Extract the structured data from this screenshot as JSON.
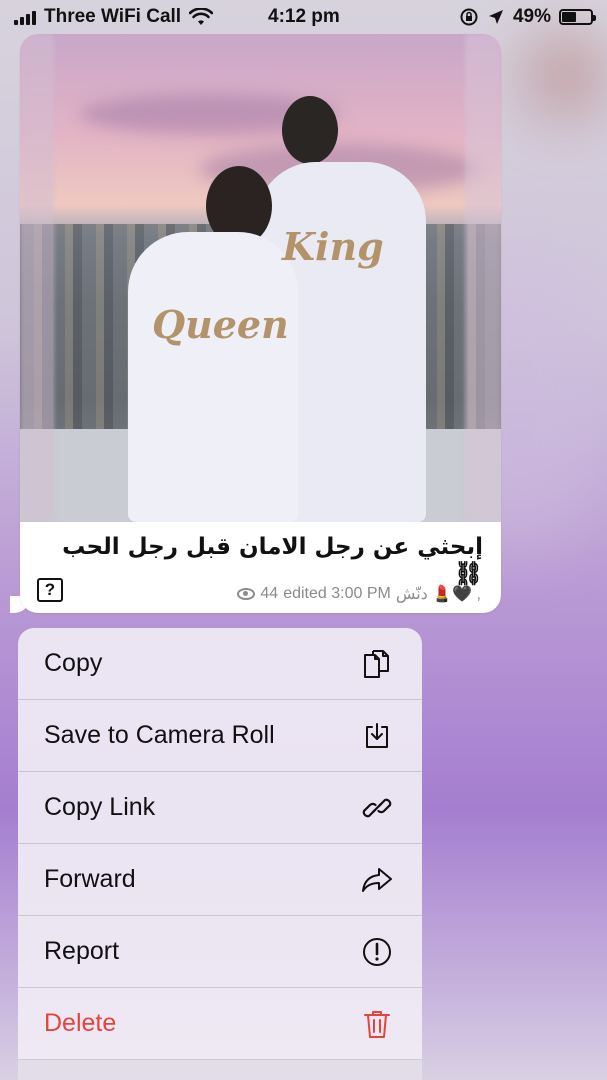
{
  "status_bar": {
    "carrier": "Three WiFi Call",
    "time": "4:12 pm",
    "battery": "49%",
    "battery_level": 0.49
  },
  "message": {
    "photo": {
      "robe_left_text": "Queen",
      "robe_right_text": "King"
    },
    "caption": "إبحثي عن رجل الامان قبل رجل الحب⛓",
    "caption_emoji": "?",
    "meta": {
      "views": "44",
      "info": "edited 3:00 PM",
      "signature": "دنّش 💄🖤 ,"
    }
  },
  "context_menu": {
    "items": [
      {
        "label": "Copy",
        "icon": "copy-icon"
      },
      {
        "label": "Save to Camera Roll",
        "icon": "save-icon"
      },
      {
        "label": "Copy Link",
        "icon": "link-icon"
      },
      {
        "label": "Forward",
        "icon": "forward-icon"
      },
      {
        "label": "Report",
        "icon": "report-icon"
      },
      {
        "label": "Delete",
        "icon": "trash-icon",
        "destructive": true
      }
    ]
  },
  "colors": {
    "destructive": "#e5443c",
    "menu_bg": "#f0ecf4",
    "bubble_bg": "#ffffff",
    "meta_text": "#8a8a8f"
  }
}
